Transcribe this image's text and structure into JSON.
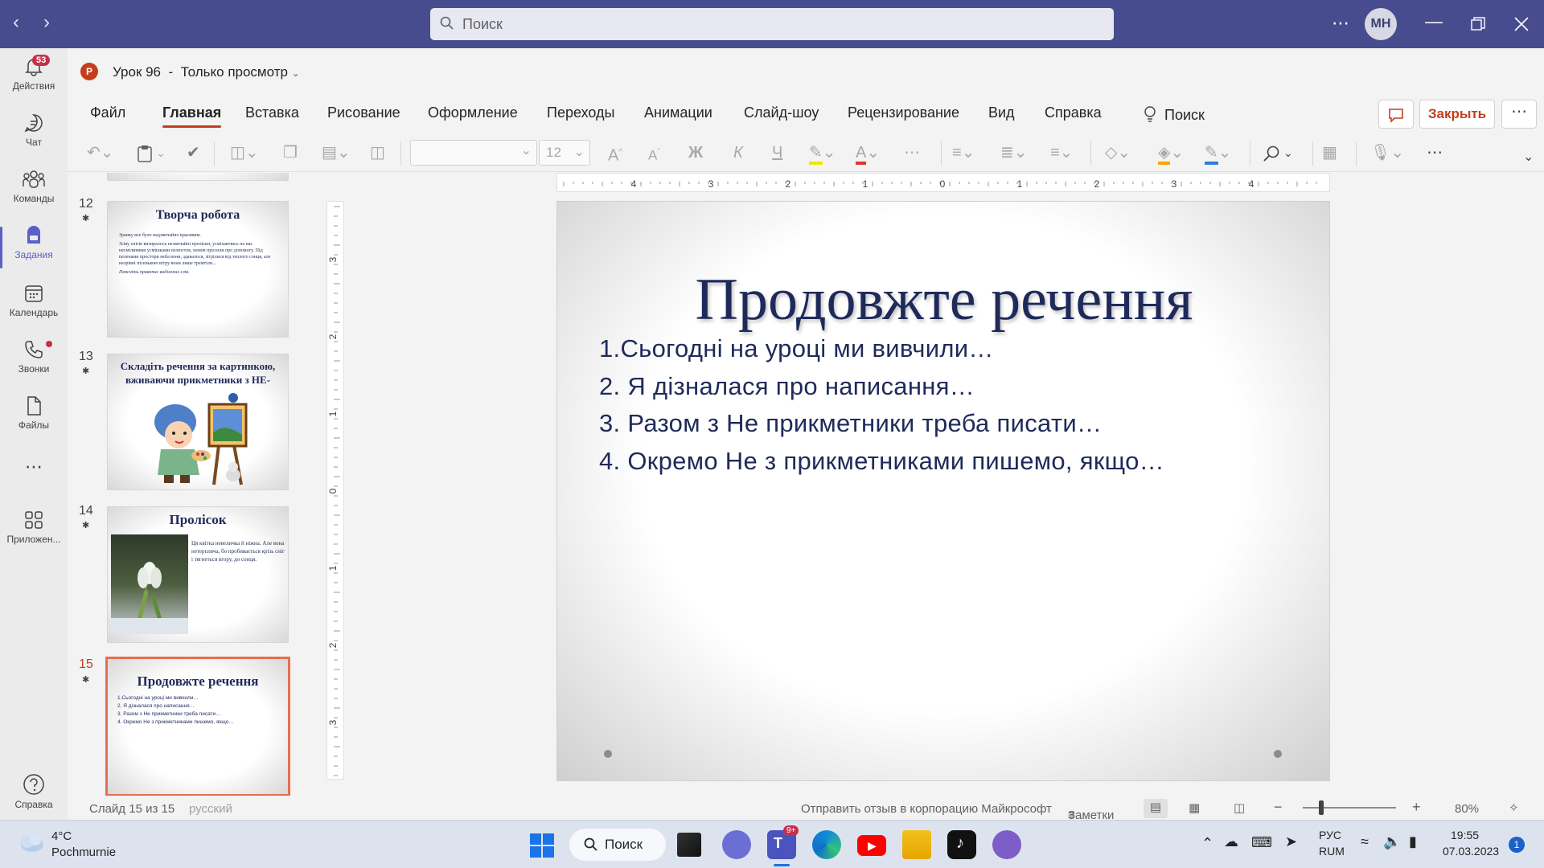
{
  "titlebar": {
    "search_placeholder": "Поиск",
    "user_initials": "МН"
  },
  "rail": {
    "items": [
      {
        "label": "Действия",
        "badge": "53"
      },
      {
        "label": "Чат"
      },
      {
        "label": "Команды"
      },
      {
        "label": "Задания"
      },
      {
        "label": "Календарь"
      },
      {
        "label": "Звонки"
      },
      {
        "label": "Файлы"
      },
      {
        "label": "Приложен..."
      },
      {
        "label": "Справка"
      }
    ]
  },
  "document": {
    "title": "Урок 96",
    "mode": "Только просмотр"
  },
  "ribbon": {
    "tabs": [
      "Файл",
      "Главная",
      "Вставка",
      "Рисование",
      "Оформление",
      "Переходы",
      "Анимации",
      "Слайд-шоу",
      "Рецензирование",
      "Вид",
      "Справка"
    ],
    "search_label": "Поиск",
    "close_label": "Закрыть",
    "font_size": "12",
    "bold_glyph": "Ж",
    "italic_glyph": "К",
    "underline_glyph": "Ч"
  },
  "thumbnails": [
    {
      "number": "12",
      "title": "Творча робота",
      "body": [
        "Зранку все було надзвичайно красивим.",
        "Зсіву снігів визиралось незвичайні проліски, усміхаючись на нас несміливими усмішками пелюсток, немов просили про допомогу. Під пеленами простори неба вони, здавалося, зігрілися від теплого сонця, але незрівні пісенькою вітру вони лише тремтіли...",
        "Поясніть правопис виділених слів."
      ]
    },
    {
      "number": "13",
      "title": "Складіть речення за картинкою, вживаючи прикметники з НЕ-"
    },
    {
      "number": "14",
      "title": "Пролісок",
      "body": [
        "Ця квітка невеличка й ніжна. Але вона нетерпляча, бо пробивається крізь сніг і тягнеться вгору, до сонця."
      ]
    },
    {
      "number": "15",
      "title": "Продовжте речення",
      "body": [
        "1.Сьогодні на уроці ми вивчили…",
        "2. Я дізналася про написання…",
        "3. Разом з Не прикметники треба писати…",
        "4. Окремо Не з прикметниками пишемо, якщо…"
      ]
    }
  ],
  "slide": {
    "title": "Продовжте речення",
    "lines": [
      "1.Сьогодні на уроці ми вивчили…",
      "2. Я дізналася про написання…",
      "3. Разом з Не прикметники треба писати…",
      "4. Окремо  Не з прикметниками пишемо, якщо…"
    ]
  },
  "ruler": {
    "h_ticks": [
      "4",
      "3",
      "2",
      "1",
      "0",
      "1",
      "2",
      "3",
      "4"
    ],
    "v_ticks": [
      "3",
      "2",
      "1",
      "0",
      "1",
      "2",
      "3"
    ]
  },
  "statusbar": {
    "slide_counter": "Слайд 15 из 15",
    "language": "русский",
    "feedback": "Отправить отзыв в корпорацию Майкрософт",
    "notes": "Заметки",
    "zoom": "80%"
  },
  "taskbar": {
    "weather_temp": "4°C",
    "weather_desc": "Pochmurnie",
    "search_label": "Поиск",
    "teams_badge": "9+",
    "lang_1": "РУС",
    "lang_2": "RUM",
    "time": "19:55",
    "date": "07.03.2023",
    "notification_count": "1"
  },
  "colors": {
    "titlebar": "#474c8f",
    "accent": "#c43e1c",
    "teams": "#5b5fc7",
    "slide_text": "#1f2a5a"
  }
}
